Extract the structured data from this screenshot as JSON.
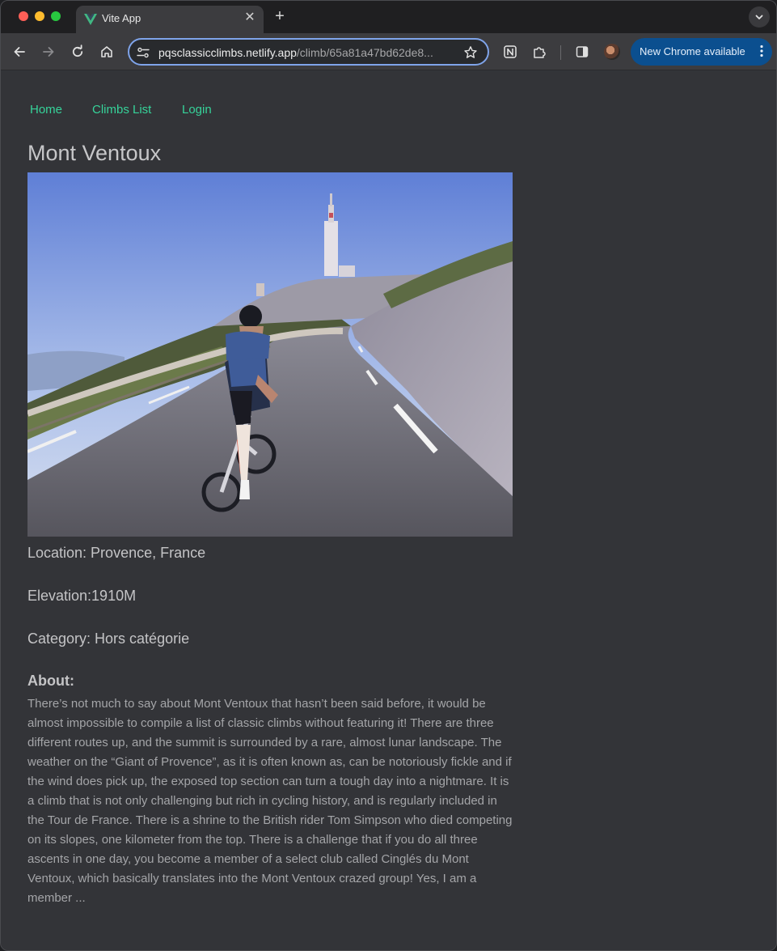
{
  "browser": {
    "tab_title": "Vite App",
    "url_host": "pqsclassicclimbs.netlify.app",
    "url_path": "/climb/65a81a47bd62de8...",
    "update_label": "New Chrome available"
  },
  "nav": {
    "home": "Home",
    "climbs_list": "Climbs List",
    "login": "Login"
  },
  "climb": {
    "name": "Mont Ventoux",
    "location": "Location: Provence, France",
    "elevation": "Elevation:1910M",
    "category": "Category: Hors catégorie",
    "about_heading": "About:",
    "about_text": "There’s not much to say about Mont Ventoux that hasn’t been said before, it would be almost impossible to compile a list of classic climbs without featuring it!  There are three different routes up, and the summit is surrounded by a rare, almost lunar landscape. The weather on the “Giant of Provence”, as it is often known as, can be notoriously fickle and if the wind does pick up, the exposed top section can turn a tough day into a nightmare. It is a climb that is not only challenging but rich in cycling history, and is regularly included in the Tour de France. There is a shrine to the British rider Tom Simpson who died competing on its slopes, one kilometer from the top. There is a challenge that if you do all three ascents in one day, you become a member of a select club called Cinglés du Mont Ventoux, which basically translates into the Mont Ventoux crazed group! Yes, I am a member ..."
  },
  "colors": {
    "nav_link": "#36d39a",
    "page_bg": "#333438",
    "omnibox_focus": "#7fa4ea",
    "update_chip": "#0b4f8f"
  },
  "icons": {
    "tab_favicon": "vue-logo-icon",
    "back": "arrow-left-icon",
    "forward": "arrow-right-icon",
    "reload": "reload-icon",
    "home": "home-icon",
    "site_info": "tune-icon",
    "bookmark": "star-icon",
    "notion": "notion-icon",
    "extensions": "puzzle-icon",
    "side_panel": "side-panel-icon",
    "menu": "kebab-menu-icon"
  }
}
